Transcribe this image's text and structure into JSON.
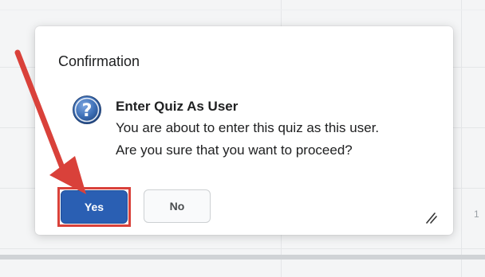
{
  "dialog": {
    "title": "Confirmation",
    "message_heading": "Enter Quiz As User",
    "message_line1": "You are about to enter this quiz as this user.",
    "message_line2": "Are you sure that you want to proceed?",
    "yes_label": "Yes",
    "no_label": "No"
  },
  "background": {
    "partial_text": "1"
  },
  "icons": {
    "question": "question-icon",
    "resize": "resize-grip-icon",
    "annotation": "red-arrow"
  },
  "colors": {
    "primary_button": "#2a5fb3",
    "annotation_red": "#d9413a",
    "icon_blue": "#3d6fb6"
  }
}
